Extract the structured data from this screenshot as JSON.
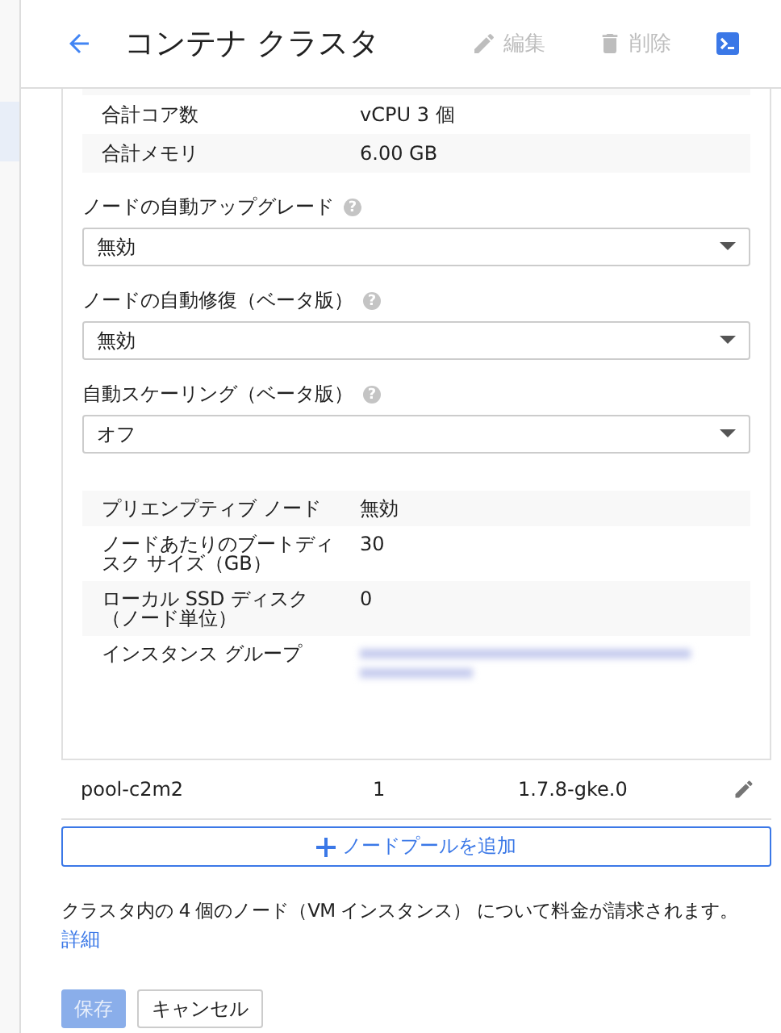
{
  "header": {
    "title": "コンテナ クラスタ",
    "actions": [
      {
        "label": "編集",
        "kind": "edit",
        "disabled": true
      },
      {
        "label": "削除",
        "kind": "delete",
        "disabled": true
      }
    ]
  },
  "sidebar": {
    "items": [
      {
        "selected": true
      }
    ]
  },
  "totals": [
    {
      "label": "合計コア数",
      "value": "vCPU 3 個"
    },
    {
      "label": "合計メモリ",
      "value": "6.00 GB"
    }
  ],
  "settings": [
    {
      "label": "ノードの自動アップグレード",
      "help": "?",
      "value": "無効"
    },
    {
      "label": "ノードの自動修復（ベータ版）",
      "help": "?",
      "value": "無効"
    },
    {
      "label": "自動スケーリング（ベータ版）",
      "help": "?",
      "value": "オフ"
    }
  ],
  "details": [
    {
      "label": "プリエンプティブ ノード",
      "value": "無効"
    },
    {
      "label": "ノードあたりのブートディスク サイズ（GB）",
      "value": "30"
    },
    {
      "label": "ローカル SSD ディスク（ノード単位）",
      "value": "0"
    },
    {
      "label": "インスタンス グループ",
      "kind": "redacted"
    }
  ],
  "pool_row": {
    "name": "pool-c2m2",
    "nodes": "1",
    "version": "1.7.8-gke.0"
  },
  "add_pool_button": "ノードプールを追加",
  "notice": "クラスタ内の 4 個のノード（VM インスタンス） について料金が請求されます。",
  "notice_link": "詳細",
  "buttons": [
    {
      "label": "保存",
      "kind": "primary",
      "disabled": true
    },
    {
      "label": "キャンセル",
      "kind": "secondary",
      "disabled": false
    }
  ]
}
